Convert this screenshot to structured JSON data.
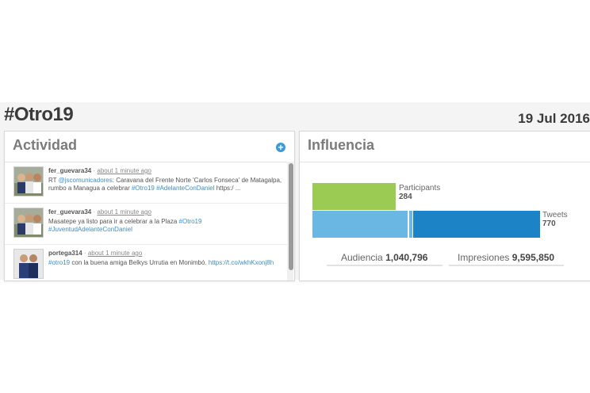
{
  "header": {
    "hashtag": "#Otro19",
    "date": "19 Jul 2016"
  },
  "actividad": {
    "title": "Actividad",
    "add_icon": "plus-circle-icon",
    "items": [
      {
        "user": "fer_guevara34",
        "separator": "·",
        "time": "about 1 minute ago",
        "text_parts": [
          {
            "t": "RT "
          },
          {
            "t": "@jscomunicadores",
            "link": true
          },
          {
            "t": ": Caravana del Frente Norte 'Carlos Fonseca' de Matagalpa, rumbo a Managua a celebrar "
          },
          {
            "t": "#Otro19",
            "link": true
          },
          {
            "t": " "
          },
          {
            "t": "#AdelanteConDaniel",
            "link": true
          },
          {
            "t": " https:/ ..."
          }
        ]
      },
      {
        "user": "fer_guevara34",
        "separator": "·",
        "time": "about 1 minute ago",
        "text_parts": [
          {
            "t": "Masatepe ya listo para ir a celebrar a la Plaza "
          },
          {
            "t": "#Otro19",
            "link": true
          },
          {
            "t": " "
          },
          {
            "t": "#JuventudAdelanteConDaniel",
            "link": true
          }
        ]
      },
      {
        "user": "portega314",
        "separator": "·",
        "time": "about 1 minute ago",
        "text_parts": [
          {
            "t": "#otro19",
            "link": true
          },
          {
            "t": " con la buena amiga Belkys Urrutia en Monimbó. "
          },
          {
            "t": "https://t.co/wkhKxonj8h",
            "link": true
          }
        ]
      }
    ]
  },
  "influencia": {
    "title": "Influencia",
    "participants_label": "Participants",
    "participants_value": "284",
    "tweets_label": "Tweets",
    "tweets_value": "770",
    "audiencia_label": "Audiencia",
    "audiencia_value": "1,040,796",
    "impresiones_label": "Impresiones",
    "impresiones_value": "9,595,850",
    "colors": {
      "participants": "#9ccb54",
      "tweets_light": "#6bb7e4",
      "tweets_dark": "#1c84c6"
    }
  }
}
